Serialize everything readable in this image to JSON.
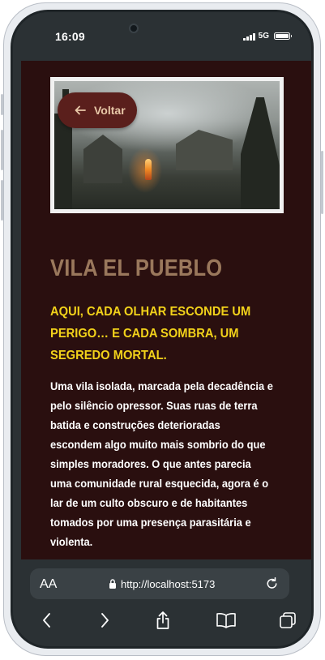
{
  "status_bar": {
    "time": "16:09",
    "network": "5G"
  },
  "back_button": {
    "label": "Voltar",
    "icon": "arrow-left-icon"
  },
  "hero_image": {
    "alt": "village scene with fog and fire"
  },
  "content": {
    "title": "VILA EL PUEBLO",
    "subtitle": "AQUI, CADA OLHAR ESCONDE UM PERIGO… E CADA SOMBRA, UM SEGREDO MORTAL.",
    "description": "Uma vila isolada, marcada pela decadência e pelo silêncio opressor. Suas ruas de terra batida e construções deterioradas escondem algo muito mais sombrio do que simples moradores. O que antes parecia uma comunidade rural esquecida, agora é o lar de um culto obscuro e de habitantes tomados por uma presença parasitária e violenta."
  },
  "browser": {
    "text_size_label": "AA",
    "url": "http://localhost:5173",
    "toolbar_icons": [
      "back-icon",
      "forward-icon",
      "share-icon",
      "bookmarks-icon",
      "tabs-icon"
    ]
  },
  "colors": {
    "page_background": "#2a0f0f",
    "title": "#9a785c",
    "subtitle": "#f2d21a",
    "button_background": "#5a1f1c",
    "button_text": "#e8c8a8",
    "browser_chrome": "#2b3134"
  }
}
